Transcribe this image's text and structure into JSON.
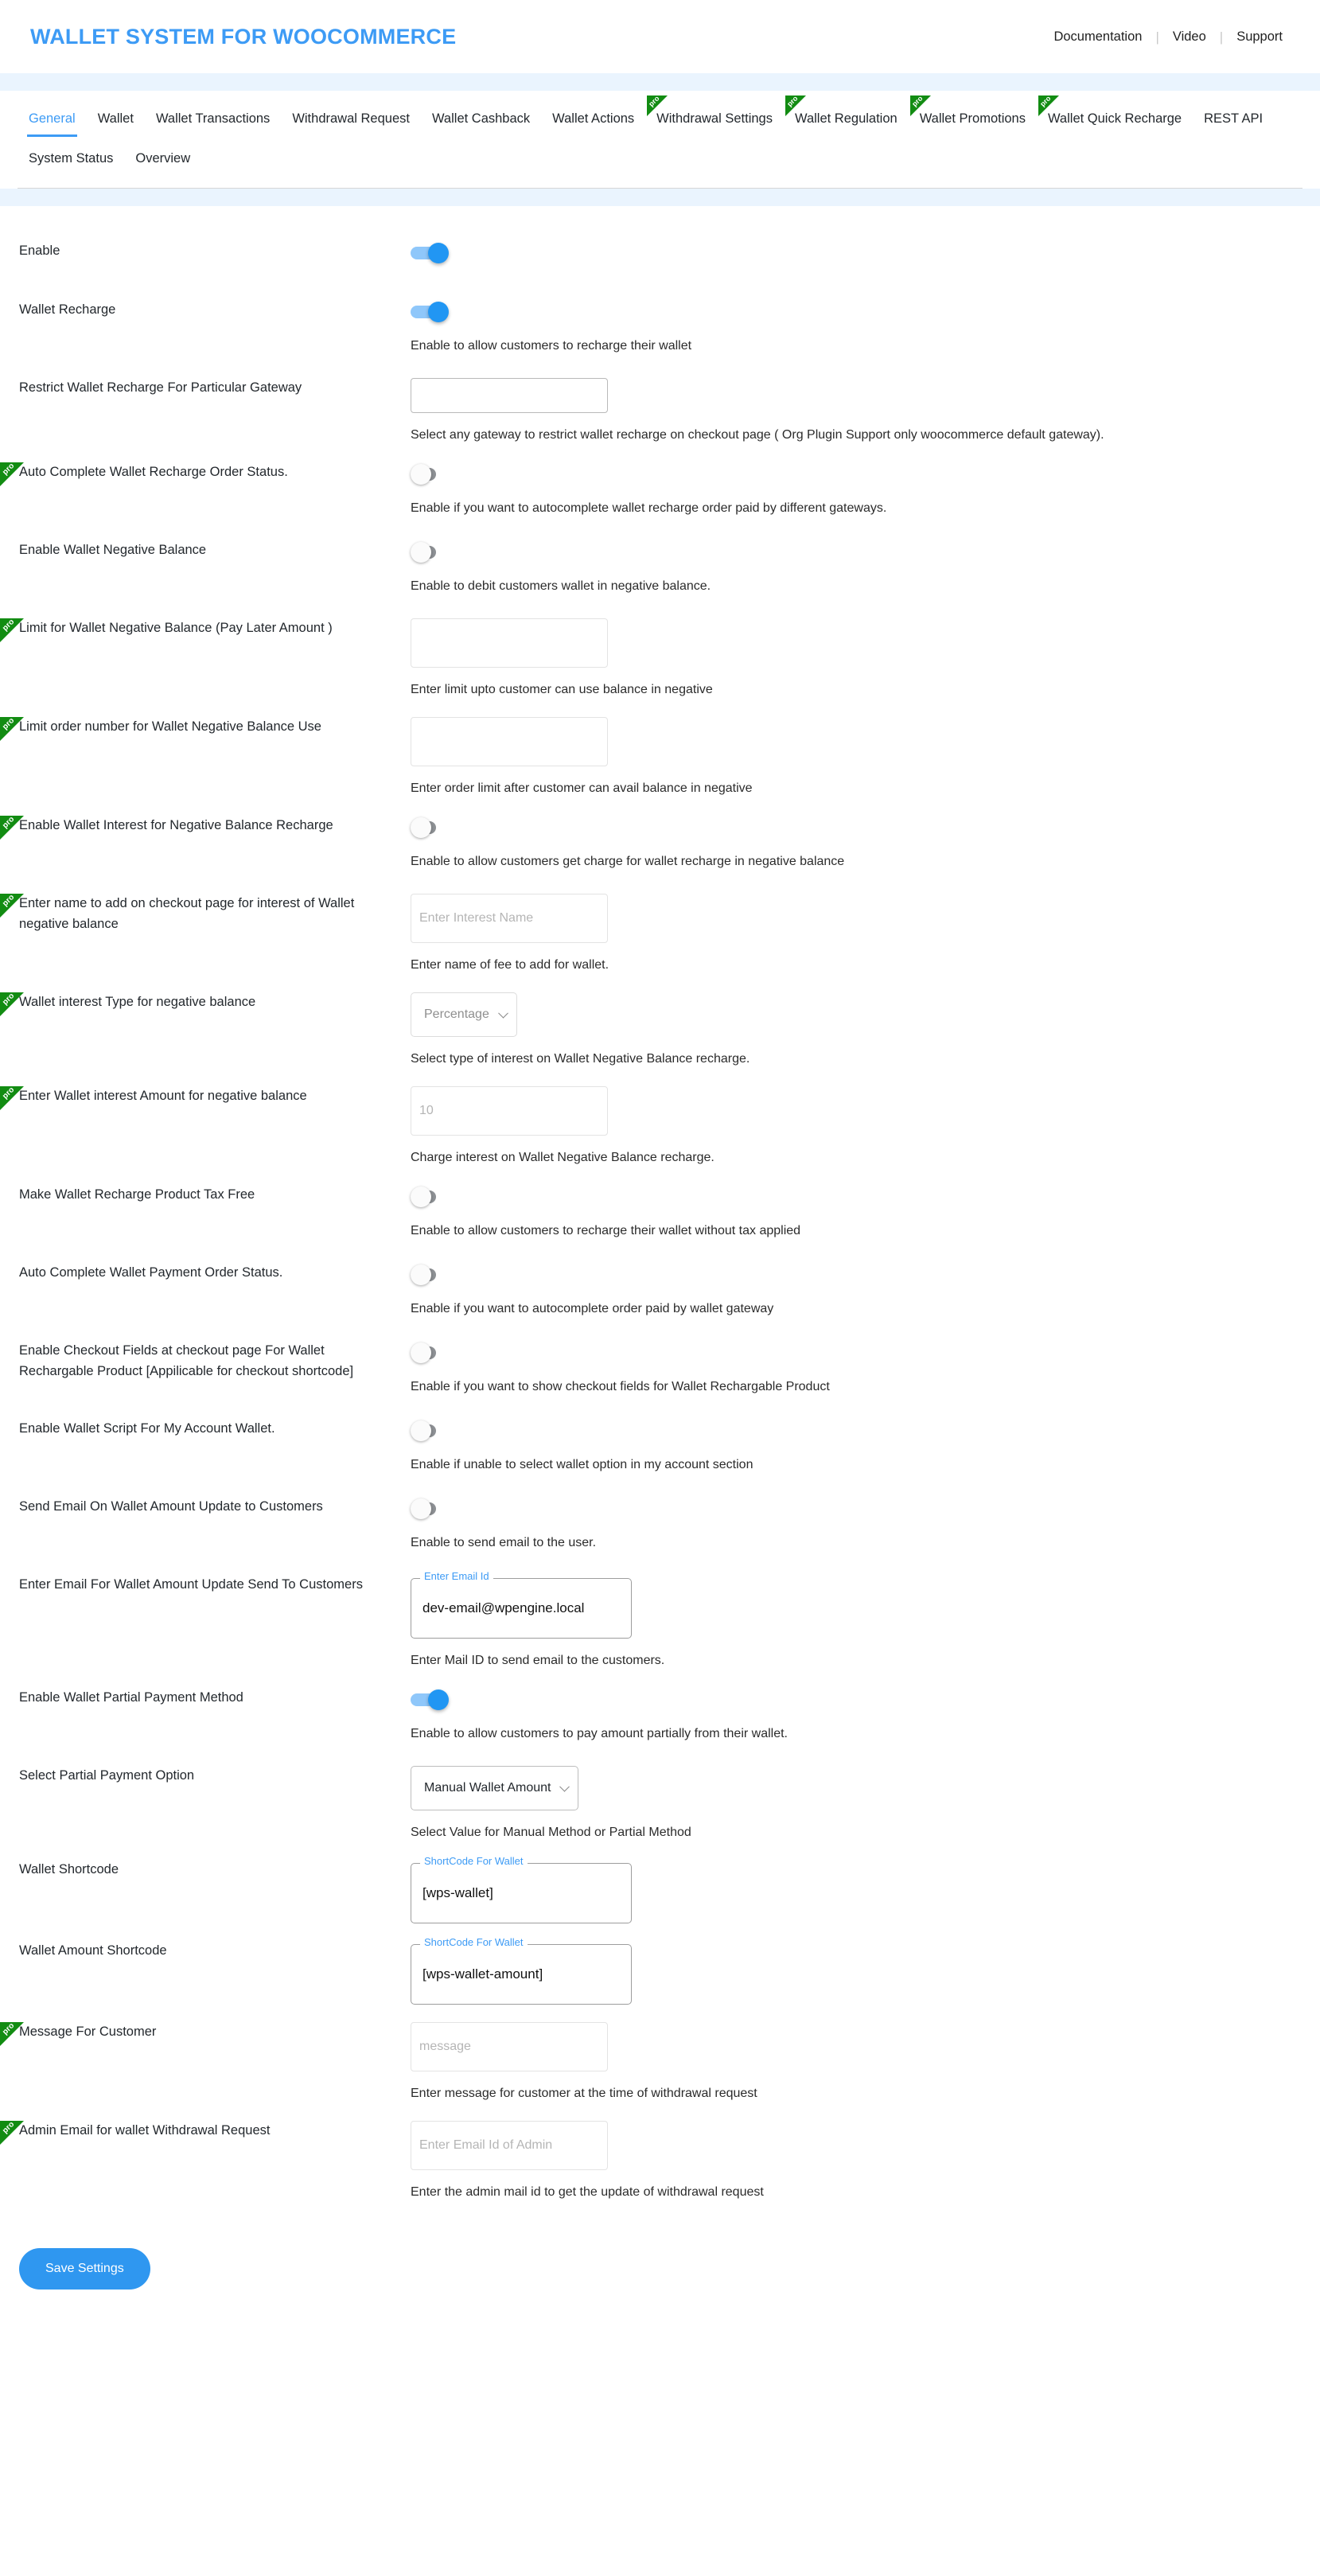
{
  "header": {
    "brand": "WALLET SYSTEM FOR WOOCOMMERCE",
    "links": [
      {
        "label": "Documentation"
      },
      {
        "label": "Video"
      },
      {
        "label": "Support"
      }
    ],
    "separator": "|"
  },
  "tabs": [
    {
      "label": "General",
      "active": true,
      "pro": false
    },
    {
      "label": "Wallet",
      "active": false,
      "pro": false
    },
    {
      "label": "Wallet Transactions",
      "active": false,
      "pro": false
    },
    {
      "label": "Withdrawal Request",
      "active": false,
      "pro": false
    },
    {
      "label": "Wallet Cashback",
      "active": false,
      "pro": false
    },
    {
      "label": "Wallet Actions",
      "active": false,
      "pro": false
    },
    {
      "label": "Withdrawal Settings",
      "active": false,
      "pro": true
    },
    {
      "label": "Wallet Regulation",
      "active": false,
      "pro": true
    },
    {
      "label": "Wallet Promotions",
      "active": false,
      "pro": true
    },
    {
      "label": "Wallet Quick Recharge",
      "active": false,
      "pro": true
    },
    {
      "label": "REST API",
      "active": false,
      "pro": false
    },
    {
      "label": "System Status",
      "active": false,
      "pro": false
    },
    {
      "label": "Overview",
      "active": false,
      "pro": false
    }
  ],
  "pro_badge_text": "pro",
  "settings": [
    {
      "label": "Enable",
      "control": "toggle",
      "state": "on",
      "pro": false,
      "help": ""
    },
    {
      "label": "Wallet Recharge",
      "control": "toggle",
      "state": "on",
      "pro": false,
      "help": "Enable to allow customers to recharge their wallet"
    },
    {
      "label": "Restrict Wallet Recharge For Particular Gateway",
      "control": "input",
      "value": "",
      "placeholder": "",
      "pro": false,
      "help": "Select any gateway to restrict wallet recharge on checkout page ( Org Plugin Support only woocommerce default gateway)."
    },
    {
      "label": "Auto Complete Wallet Recharge Order Status.",
      "control": "toggle",
      "state": "off",
      "pro": true,
      "help": "Enable if you want to autocomplete wallet recharge order paid by different gateways."
    },
    {
      "label": "Enable Wallet Negative Balance",
      "control": "toggle",
      "state": "off",
      "pro": false,
      "help": "Enable to debit customers wallet in negative balance."
    },
    {
      "label": "Limit for Wallet Negative Balance (Pay Later Amount )",
      "control": "input",
      "value": "",
      "placeholder": "",
      "disabled": true,
      "pro": true,
      "help": "Enter limit upto customer can use balance in negative"
    },
    {
      "label": "Limit order number for Wallet Negative Balance Use",
      "control": "input",
      "value": "",
      "placeholder": "",
      "disabled": true,
      "pro": true,
      "help": "Enter order limit after customer can avail balance in negative"
    },
    {
      "label": "Enable Wallet Interest for Negative Balance Recharge",
      "control": "toggle",
      "state": "off",
      "pro": true,
      "help": "Enable to allow customers get charge for wallet recharge in negative balance"
    },
    {
      "label": "Enter name to add on checkout page for interest of Wallet negative balance",
      "control": "input",
      "value": "",
      "placeholder": "Enter Interest Name",
      "disabled": true,
      "pro": true,
      "help": "Enter name of fee to add for wallet."
    },
    {
      "label": "Wallet interest Type for negative balance",
      "control": "select",
      "value": "Percentage",
      "disabled": true,
      "pro": true,
      "help": "Select type of interest on Wallet Negative Balance recharge."
    },
    {
      "label": "Enter Wallet interest Amount for negative balance",
      "control": "input",
      "value": "",
      "placeholder": "10",
      "disabled": true,
      "pro": true,
      "help": "Charge interest on Wallet Negative Balance recharge."
    },
    {
      "label": "Make Wallet Recharge Product Tax Free",
      "control": "toggle",
      "state": "off",
      "pro": false,
      "help": "Enable to allow customers to recharge their wallet without tax applied"
    },
    {
      "label": "Auto Complete Wallet Payment Order Status.",
      "control": "toggle",
      "state": "off",
      "pro": false,
      "help": "Enable if you want to autocomplete order paid by wallet gateway"
    },
    {
      "label": "Enable Checkout Fields at checkout page For Wallet Rechargable Product [Appilicable for checkout shortcode]",
      "control": "toggle",
      "state": "off",
      "pro": false,
      "help": "Enable if you want to show checkout fields for Wallet Rechargable Product"
    },
    {
      "label": "Enable Wallet Script For My Account Wallet.",
      "control": "toggle",
      "state": "off",
      "pro": false,
      "help": "Enable if unable to select wallet option in my account section"
    },
    {
      "label": "Send Email On Wallet Amount Update to Customers",
      "control": "toggle",
      "state": "off",
      "pro": false,
      "help": "Enable to send email to the user."
    },
    {
      "label": "Enter Email For Wallet Amount Update Send To Customers",
      "control": "mfield",
      "legend": "Enter Email Id",
      "value": "dev-email@wpengine.local",
      "pro": false,
      "help": "Enter Mail ID to send email to the customers."
    },
    {
      "label": "Enable Wallet Partial Payment Method",
      "control": "toggle",
      "state": "on",
      "pro": false,
      "help": "Enable to allow customers to pay amount partially from their wallet."
    },
    {
      "label": "Select Partial Payment Option",
      "control": "select",
      "value": "Manual Wallet Amount",
      "disabled": false,
      "pro": false,
      "help": "Select Value for Manual Method or Partial Method"
    },
    {
      "label": "Wallet Shortcode",
      "control": "mfield",
      "legend": "ShortCode For Wallet",
      "value": "[wps-wallet]",
      "pro": false,
      "help": ""
    },
    {
      "label": "Wallet Amount Shortcode",
      "control": "mfield",
      "legend": "ShortCode For Wallet",
      "value": "[wps-wallet-amount]",
      "pro": false,
      "help": ""
    },
    {
      "label": "Message For Customer",
      "control": "input",
      "value": "",
      "placeholder": "message",
      "disabled": true,
      "pro": true,
      "help": "Enter message for customer at the time of withdrawal request"
    },
    {
      "label": "Admin Email for wallet Withdrawal Request",
      "control": "input",
      "value": "",
      "placeholder": "Enter Email Id of Admin",
      "disabled": true,
      "pro": true,
      "help": "Enter the admin mail id to get the update of withdrawal request"
    }
  ],
  "save_button": {
    "label": "Save Settings"
  }
}
